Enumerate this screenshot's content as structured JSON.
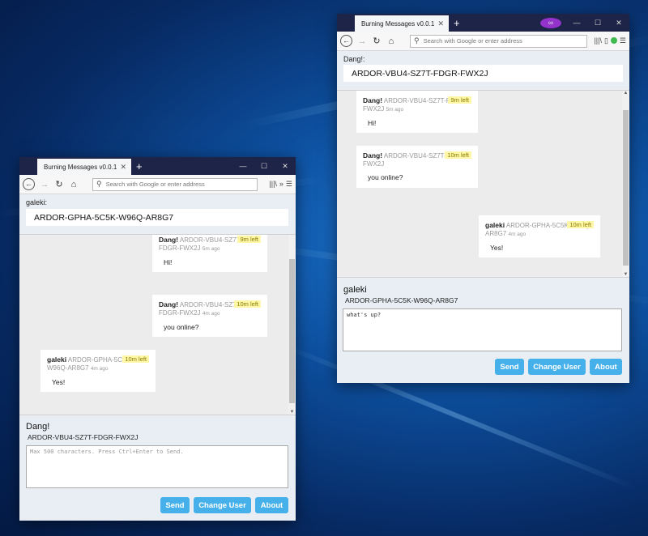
{
  "browser": {
    "tab_title": "Burning Messages v0.0.1",
    "tab_close": "✕",
    "new_tab": "+",
    "url_placeholder": "Search with Google or enter address"
  },
  "window_left": {
    "user_label": "galeki:",
    "address": "ARDOR-GPHA-5C5K-W96Q-AR8G7",
    "messages": [
      {
        "sender": "Dang!",
        "addr": "ARDOR-VBU4-SZ7T-FDGR-FWX2J",
        "ago": "5m ago",
        "left": "9m left",
        "text": "Hi!"
      },
      {
        "sender": "Dang!",
        "addr": "ARDOR-VBU4-SZ7T-FDGR-FWX2J",
        "ago": "4m ago",
        "left": "10m left",
        "text": "you online?"
      },
      {
        "sender": "galeki",
        "addr": "ARDOR-GPHA-5C5K-W96Q-AR8G7",
        "ago": "4m ago",
        "left": "10m left",
        "text": "Yes!"
      }
    ],
    "compose": {
      "recipient_name": "Dang!",
      "recipient_address": "ARDOR-VBU4-SZ7T-FDGR-FWX2J",
      "placeholder": "Max 500 characters. Press Ctrl+Enter to Send.",
      "value": ""
    }
  },
  "window_right": {
    "user_label": "Dang!:",
    "address": "ARDOR-VBU4-SZ7T-FDGR-FWX2J",
    "messages": [
      {
        "sender": "Dang!",
        "addr": "ARDOR-VBU4-SZ7T-FDGR-FWX2J",
        "ago": "5m ago",
        "left": "9m left",
        "text": "Hi!"
      },
      {
        "sender": "Dang!",
        "addr": "ARDOR-VBU4-SZ7T-FDGR-FWX2J",
        "ago": "4m ago",
        "left": "10m left",
        "text": "you online?"
      },
      {
        "sender": "galeki",
        "addr": "ARDOR-GPHA-5C5K-W96Q-AR8G7",
        "ago": "4m ago",
        "left": "10m left",
        "text": "Yes!"
      }
    ],
    "compose": {
      "recipient_name": "galeki",
      "recipient_address": "ARDOR-GPHA-5C5K-W96Q-AR8G7",
      "placeholder": "",
      "value": "what's up?"
    }
  },
  "buttons": {
    "send": "Send",
    "change_user": "Change User",
    "about": "About"
  },
  "colors": {
    "accent": "#45b0ea",
    "titlebar": "#1d2448",
    "badge_bg": "#fff7a8"
  }
}
